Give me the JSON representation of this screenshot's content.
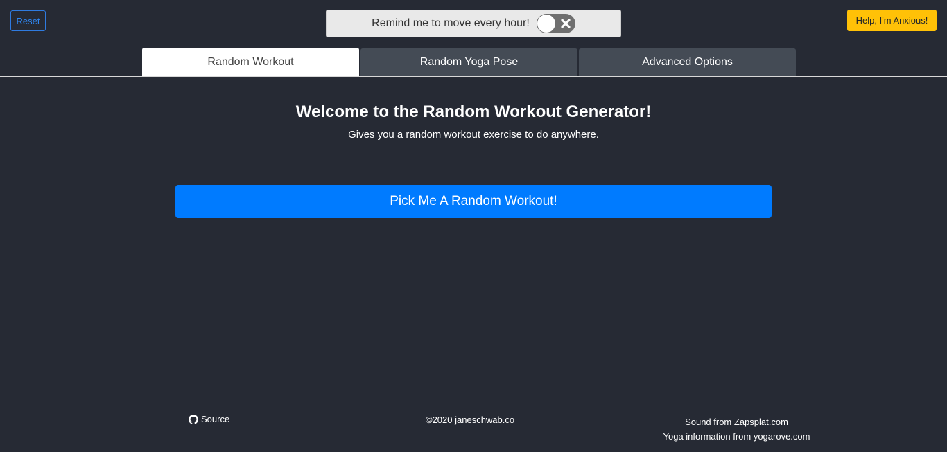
{
  "header": {
    "reset_label": "Reset",
    "remind_label": "Remind me to move every hour!",
    "remind_enabled": false,
    "help_label": "Help, I'm Anxious!"
  },
  "tabs": [
    {
      "label": "Random Workout",
      "active": true
    },
    {
      "label": "Random Yoga Pose",
      "active": false
    },
    {
      "label": "Advanced Options",
      "active": false
    }
  ],
  "main": {
    "title": "Welcome to the Random Workout Generator!",
    "subtitle": "Gives you a random workout exercise to do anywhere.",
    "pick_button": "Pick Me A Random Workout!"
  },
  "footer": {
    "source_label": "Source",
    "source_icon": "github-icon",
    "copyright": "©2020 janeschwab.co",
    "sound_credit": "Sound from Zapsplat.com",
    "yoga_credit": "Yoga information from yogarove.com"
  },
  "colors": {
    "background": "#262a34",
    "primary": "#007bff",
    "warning": "#ffc107",
    "tab_inactive": "#444b55"
  }
}
